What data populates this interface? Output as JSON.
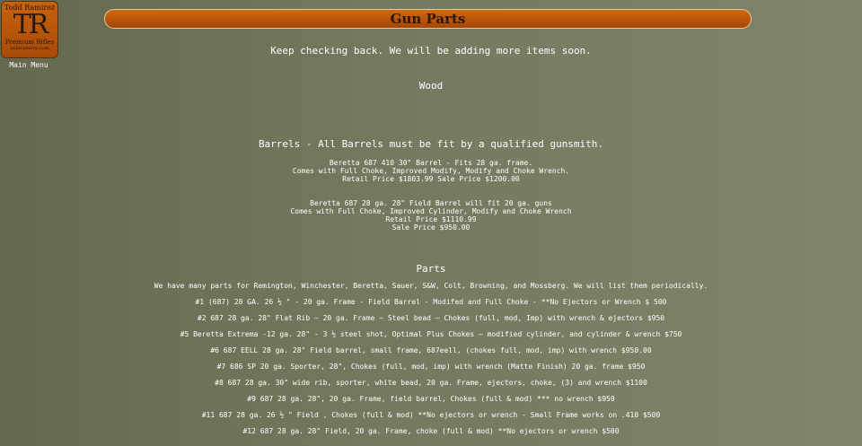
{
  "logo": {
    "name": "Todd Ramirez",
    "monogram": "TR",
    "tagline": "Premium Rifles",
    "url": "toddramirez.com"
  },
  "nav": {
    "main_menu": "Main Menu"
  },
  "header": {
    "title": "Gun Parts"
  },
  "notice": "Keep checking back. We will be adding more items soon.",
  "sections": {
    "wood": "Wood",
    "barrels": "Barrels - All Barrels must be fit by a qualified gunsmith.",
    "parts": "Parts"
  },
  "barrels": [
    {
      "line1": "Beretta 687 410 30\" Barrel - Fits 28 ga. frame.",
      "line2": "Comes with Full Choke, Improved Modify, Modify and Choke Wrench.",
      "line3": "Retail Price $1803.99 Sale Price $1200.00"
    },
    {
      "line1": "Beretta 687 28 ga. 28\" Field Barrel will fit 20 ga. guns",
      "line2": "Comes with Full Choke, Improved Cylinder, Modify and Choke Wrench",
      "line3": "Retail Price $1110.99",
      "line4": "Sale Price $950.00"
    }
  ],
  "parts_intro": "We have many parts for Remington, Winchester, Beretta, Sauer, S&W, Colt, Browning, and Mossberg. We will list them periodically.",
  "parts": [
    "#1 (687) 28 GA. 26 ½ \" - 20 ga. Frame - Field Barrel - Modifed and Full Choke - **No Ejectors or Wrench $ 500",
    "#2 687 28 ga. 28\" Flat Rib – 20 ga. Frame – Steel bead – Chokes (full, mod, Imp) with wrench & ejectors $950",
    "#5 Beretta Extrema -12 ga. 28\" - 3 ½ steel shot, Optimal Plus Chokes – modified cylinder, and cylinder & wrench $750",
    "#6 687 EELL 28 ga. 28\" Field barrel, small frame, 687eell, (chokes full, mod, imp) with wrench $950.00",
    "#7 686 SP 20 ga. Sporter, 28\", Chokes (full, mod, imp) with wrench (Matte Finish) 20 ga. frame $950",
    "#8 687 28 ga. 30\" wide rib, sporter, white bead, 20 ga. Frame, ejectors, choke, (3) and wrench $1100",
    "#9 687 28 ga. 28\", 20 ga. Frame, field barrel, Chokes (full & mod) *** no wrench $950",
    "#11 687 28 ga. 26 ½ \" Field , Chokes (full & mod) **No ejectors or wrench - Small Frame works on .410 $500",
    "#12 687 28 ga. 28\" Field, 20 ga. Frame, choke (full & mod) **No ejectors or wrench $500"
  ]
}
